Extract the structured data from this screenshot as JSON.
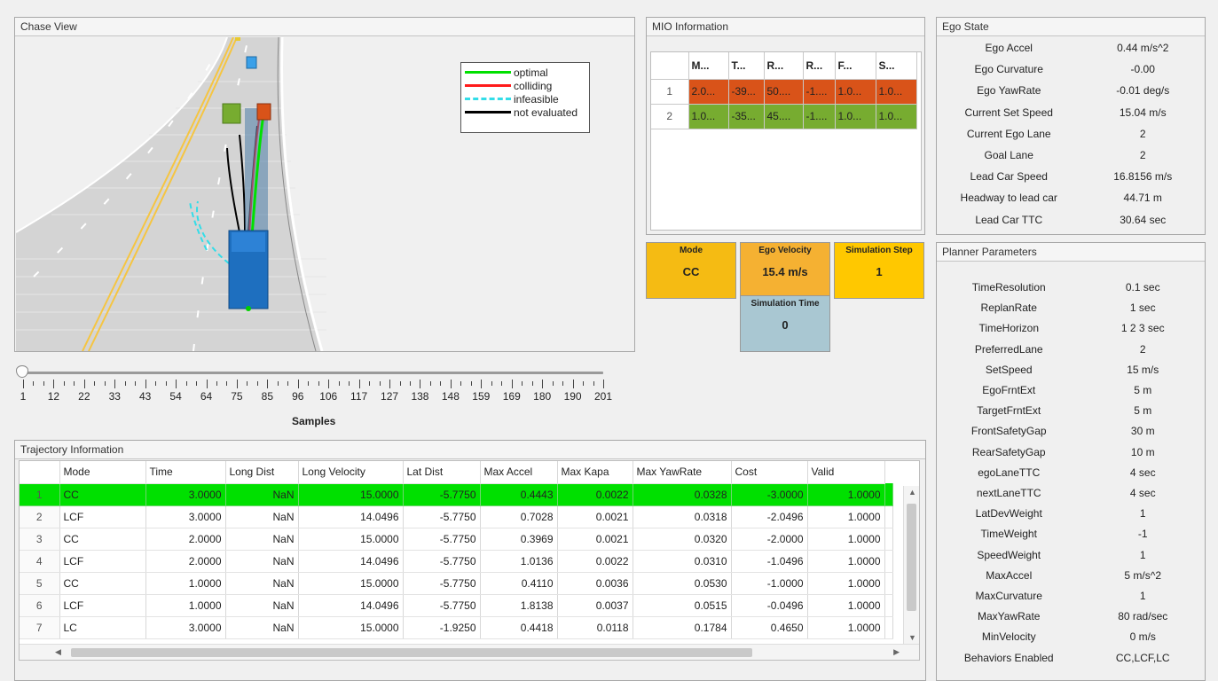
{
  "chase_view": {
    "title": "Chase View",
    "legend": [
      {
        "label": "optimal",
        "color": "#00e000",
        "style": "solid"
      },
      {
        "label": "colliding",
        "color": "#ff1a1a",
        "style": "solid"
      },
      {
        "label": "infeasible",
        "color": "#33dde8",
        "style": "dashed"
      },
      {
        "label": "not evaluated",
        "color": "#000000",
        "style": "solid"
      }
    ]
  },
  "slider": {
    "caption": "Samples",
    "ticks": [
      "1",
      "12",
      "22",
      "33",
      "43",
      "54",
      "64",
      "75",
      "85",
      "96",
      "106",
      "117",
      "127",
      "138",
      "148",
      "159",
      "169",
      "180",
      "190",
      "201"
    ]
  },
  "trajectory": {
    "title": "Trajectory Information",
    "columns": [
      "Mode",
      "Time",
      "Long Dist",
      "Long Velocity",
      "Lat Dist",
      "Max Accel",
      "Max Kapa",
      "Max YawRate",
      "Cost",
      "Valid"
    ],
    "rows": [
      {
        "idx": "1",
        "mode": "CC",
        "time": "3.0000",
        "long_dist": "NaN",
        "long_vel": "15.0000",
        "lat_dist": "-5.7750",
        "max_accel": "0.4443",
        "max_kapa": "0.0022",
        "max_yaw": "0.0328",
        "cost": "-3.0000",
        "valid": "1.0000"
      },
      {
        "idx": "2",
        "mode": "LCF",
        "time": "3.0000",
        "long_dist": "NaN",
        "long_vel": "14.0496",
        "lat_dist": "-5.7750",
        "max_accel": "0.7028",
        "max_kapa": "0.0021",
        "max_yaw": "0.0318",
        "cost": "-2.0496",
        "valid": "1.0000"
      },
      {
        "idx": "3",
        "mode": "CC",
        "time": "2.0000",
        "long_dist": "NaN",
        "long_vel": "15.0000",
        "lat_dist": "-5.7750",
        "max_accel": "0.3969",
        "max_kapa": "0.0021",
        "max_yaw": "0.0320",
        "cost": "-2.0000",
        "valid": "1.0000"
      },
      {
        "idx": "4",
        "mode": "LCF",
        "time": "2.0000",
        "long_dist": "NaN",
        "long_vel": "14.0496",
        "lat_dist": "-5.7750",
        "max_accel": "1.0136",
        "max_kapa": "0.0022",
        "max_yaw": "0.0310",
        "cost": "-1.0496",
        "valid": "1.0000"
      },
      {
        "idx": "5",
        "mode": "CC",
        "time": "1.0000",
        "long_dist": "NaN",
        "long_vel": "15.0000",
        "lat_dist": "-5.7750",
        "max_accel": "0.4110",
        "max_kapa": "0.0036",
        "max_yaw": "0.0530",
        "cost": "-1.0000",
        "valid": "1.0000"
      },
      {
        "idx": "6",
        "mode": "LCF",
        "time": "1.0000",
        "long_dist": "NaN",
        "long_vel": "14.0496",
        "lat_dist": "-5.7750",
        "max_accel": "1.8138",
        "max_kapa": "0.0037",
        "max_yaw": "0.0515",
        "cost": "-0.0496",
        "valid": "1.0000"
      },
      {
        "idx": "7",
        "mode": "LC",
        "time": "3.0000",
        "long_dist": "NaN",
        "long_vel": "15.0000",
        "lat_dist": "-1.9250",
        "max_accel": "0.4418",
        "max_kapa": "0.0118",
        "max_yaw": "0.1784",
        "cost": "0.4650",
        "valid": "1.0000"
      }
    ]
  },
  "mio": {
    "title": "MIO Information",
    "columns": [
      "M...",
      "T...",
      "R...",
      "R...",
      "F...",
      "S..."
    ],
    "rows": [
      {
        "idx": "1",
        "cells": [
          "2.0...",
          "-39...",
          "50....",
          "-1....",
          "1.0...",
          "1.0..."
        ],
        "color": "#d95319"
      },
      {
        "idx": "2",
        "cells": [
          "1.0...",
          "-35...",
          "45....",
          "-1....",
          "1.0...",
          "1.0..."
        ],
        "color": "#77ac30"
      }
    ]
  },
  "status": {
    "mode": {
      "label": "Mode",
      "value": "CC",
      "color": "#f5bb13"
    },
    "ego_velocity": {
      "label": "Ego Velocity",
      "value": "15.4 m/s",
      "color": "#f5b132"
    },
    "simulation_step": {
      "label": "Simulation Step",
      "value": "1",
      "color": "#ffc800"
    },
    "simulation_time": {
      "label": "Simulation Time",
      "value": "0",
      "color": "#a9c7d2"
    }
  },
  "ego_state": {
    "title": "Ego State",
    "items": [
      {
        "k": "Ego Accel",
        "v": "0.44 m/s^2"
      },
      {
        "k": "Ego Curvature",
        "v": "-0.00"
      },
      {
        "k": "Ego YawRate",
        "v": "-0.01 deg/s"
      },
      {
        "k": "Current Set Speed",
        "v": "15.04 m/s"
      },
      {
        "k": "Current Ego Lane",
        "v": "2"
      },
      {
        "k": "Goal Lane",
        "v": "2"
      },
      {
        "k": "Lead Car Speed",
        "v": "16.8156 m/s"
      },
      {
        "k": "Headway to lead car",
        "v": "44.71 m"
      },
      {
        "k": "Lead Car TTC",
        "v": "30.64 sec"
      }
    ]
  },
  "planner": {
    "title": "Planner  Parameters",
    "items": [
      {
        "k": "TimeResolution",
        "v": "0.1 sec"
      },
      {
        "k": "ReplanRate",
        "v": "1 sec"
      },
      {
        "k": "TimeHorizon",
        "v": "1  2  3 sec"
      },
      {
        "k": "PreferredLane",
        "v": "2"
      },
      {
        "k": "SetSpeed",
        "v": "15 m/s"
      },
      {
        "k": "EgoFrntExt",
        "v": "5 m"
      },
      {
        "k": "TargetFrntExt",
        "v": "5 m"
      },
      {
        "k": "FrontSafetyGap",
        "v": "30 m"
      },
      {
        "k": "RearSafetyGap",
        "v": "10 m"
      },
      {
        "k": "egoLaneTTC",
        "v": "4 sec"
      },
      {
        "k": "nextLaneTTC",
        "v": "4 sec"
      },
      {
        "k": "LatDevWeight",
        "v": "1"
      },
      {
        "k": "TimeWeight",
        "v": "-1"
      },
      {
        "k": "SpeedWeight",
        "v": "1"
      },
      {
        "k": "MaxAccel",
        "v": "5 m/s^2"
      },
      {
        "k": "MaxCurvature",
        "v": "1"
      },
      {
        "k": "MaxYawRate",
        "v": "80 rad/sec"
      },
      {
        "k": "MinVelocity",
        "v": "0 m/s"
      },
      {
        "k": "Behaviors Enabled",
        "v": "CC,LCF,LC"
      }
    ]
  }
}
